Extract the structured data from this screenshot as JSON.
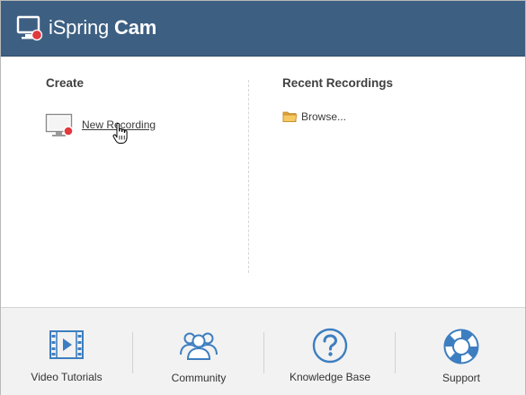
{
  "header": {
    "brand_light": "iSpring",
    "brand_bold": "Cam",
    "background_color": "#3d5f82"
  },
  "create": {
    "title": "Create",
    "new_recording_label": "New Recording",
    "icon": "screen-record-icon"
  },
  "recent": {
    "title": "Recent Recordings",
    "browse_label": "Browse...",
    "icon": "folder-icon"
  },
  "footer": {
    "items": [
      {
        "label": "Video Tutorials",
        "icon": "film-play-icon"
      },
      {
        "label": "Community",
        "icon": "people-icon"
      },
      {
        "label": "Knowledge Base",
        "icon": "question-circle-icon"
      },
      {
        "label": "Support",
        "icon": "lifebuoy-icon"
      }
    ]
  },
  "colors": {
    "accent_blue": "#3d7ec0",
    "record_red": "#e0393e"
  }
}
